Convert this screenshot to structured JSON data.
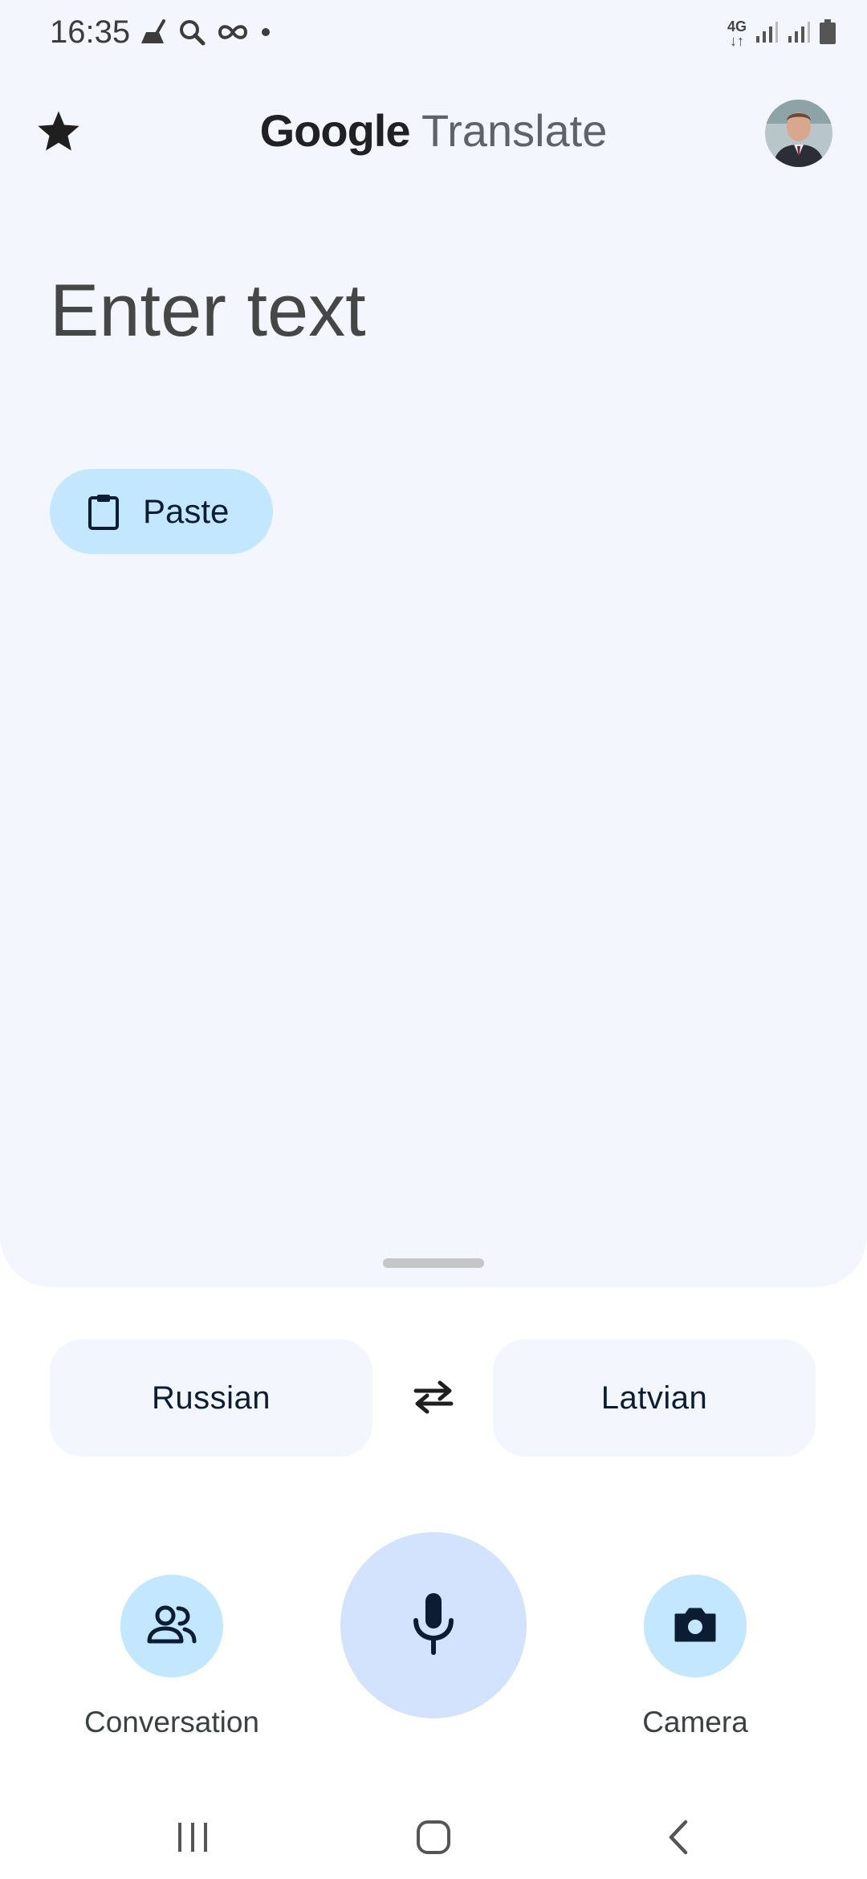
{
  "status_bar": {
    "time": "16:35",
    "network_label": "4G",
    "left_icons": [
      "cleaner-icon",
      "search-icon",
      "infinity-icon",
      "dot-icon"
    ],
    "right_icons": [
      "signal-icon",
      "signal-icon",
      "battery-icon"
    ]
  },
  "header": {
    "brand": "Google",
    "product": "Translate",
    "saved_icon": "star-icon",
    "avatar": "profile-avatar"
  },
  "input": {
    "placeholder": "Enter text",
    "value": ""
  },
  "paste": {
    "label": "Paste",
    "icon": "clipboard-icon"
  },
  "languages": {
    "source": "Russian",
    "target": "Latvian",
    "swap_icon": "swap-arrows-icon"
  },
  "actions": {
    "conversation": {
      "label": "Conversation",
      "icon": "people-icon"
    },
    "voice": {
      "icon": "mic-icon"
    },
    "camera": {
      "label": "Camera",
      "icon": "camera-icon"
    }
  },
  "nav": {
    "items": [
      "recents-icon",
      "home-icon",
      "back-icon"
    ]
  },
  "colors": {
    "panel_bg": "#f3f6fc",
    "chip_blue": "#c2e7ff",
    "mic_bg": "#d3e3fd",
    "dark_text": "#0b1d33"
  }
}
